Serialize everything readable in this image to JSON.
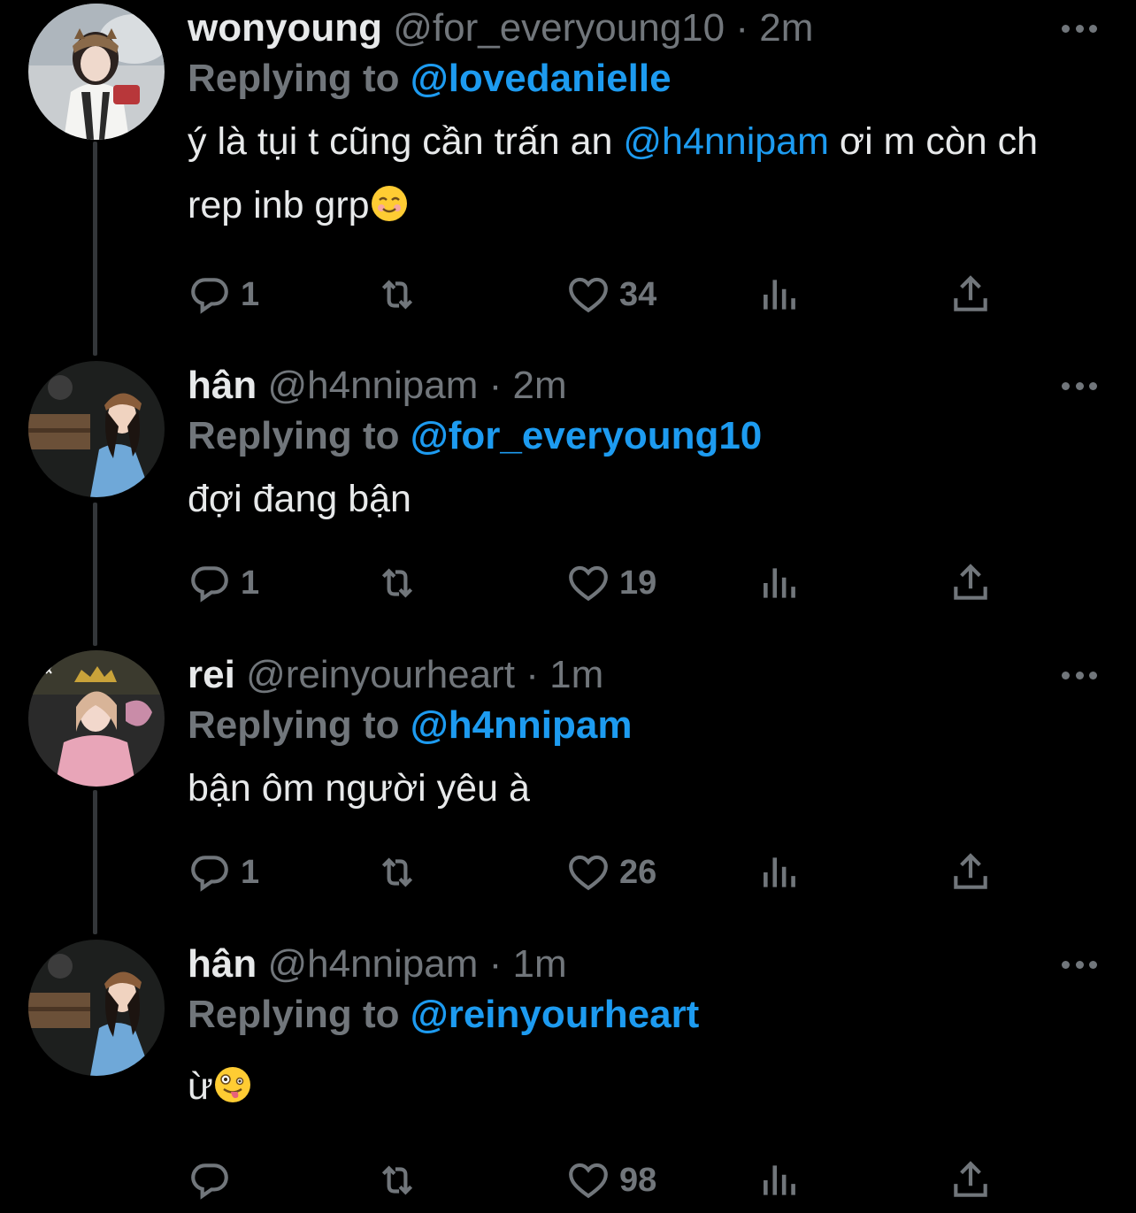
{
  "theme": {
    "background": "#000000",
    "text": "#e7e9ea",
    "secondary": "#71767b",
    "accent": "#1d9bf0",
    "thread_line": "#333639"
  },
  "tweets": [
    {
      "display_name": "wonyoung",
      "handle": "@for_everyoung10",
      "separator": "·",
      "time": "2m",
      "replying_label": "Replying to",
      "replying_to": "@lovedanielle",
      "text_before": "ý là tụi t cũng cần trấn an ",
      "text_mention": "@h4nnipam",
      "text_after": " ơi m còn ch rep inb grp",
      "emoji": "smiling-face-emoji",
      "replies": "1",
      "likes": "34",
      "avatar": "avatar-wonyoung"
    },
    {
      "display_name": "hân",
      "handle": "@h4nnipam",
      "separator": "·",
      "time": "2m",
      "replying_label": "Replying to",
      "replying_to": "@for_everyoung10",
      "text": "đợi đang bận",
      "replies": "1",
      "likes": "19",
      "avatar": "avatar-han"
    },
    {
      "display_name": "rei",
      "handle": "@reinyourheart",
      "separator": "·",
      "time": "1m",
      "replying_label": "Replying to",
      "replying_to": "@h4nnipam",
      "text": "bận ôm người yêu à",
      "replies": "1",
      "likes": "26",
      "avatar": "avatar-rei"
    },
    {
      "display_name": "hân",
      "handle": "@h4nnipam",
      "separator": "·",
      "time": "1m",
      "replying_label": "Replying to",
      "replying_to": "@reinyourheart",
      "text": "ừ",
      "emoji": "zany-face-emoji",
      "replies": "",
      "likes": "98",
      "avatar": "avatar-han"
    }
  ]
}
